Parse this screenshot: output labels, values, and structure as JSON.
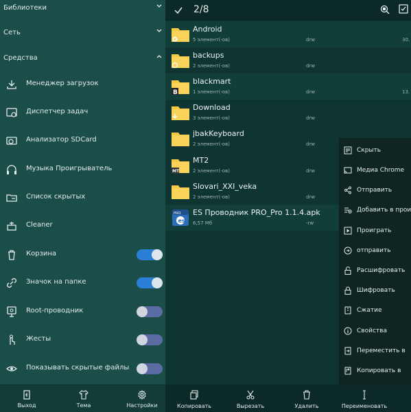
{
  "drawer": {
    "sections": [
      {
        "label": "Библиотеки",
        "expanded": false
      },
      {
        "label": "Сеть",
        "expanded": false
      },
      {
        "label": "Средства",
        "expanded": true
      }
    ],
    "items": [
      {
        "label": "Менеджер загрузок",
        "icon": "download-icon"
      },
      {
        "label": "Диспетчер задач",
        "icon": "task-manager-icon"
      },
      {
        "label": "Анализатор SDCard",
        "icon": "sdcard-analyzer-icon"
      },
      {
        "label": "Музыка Проигрыватель",
        "icon": "headphones-icon"
      },
      {
        "label": "Список скрытых",
        "icon": "hidden-list-icon"
      },
      {
        "label": "Cleaner",
        "icon": "cleaner-icon"
      },
      {
        "label": "Корзина",
        "icon": "trash-icon",
        "toggle": true
      },
      {
        "label": "Значок на папке",
        "icon": "link-icon",
        "toggle": true
      },
      {
        "label": "Root-проводник",
        "icon": "root-icon",
        "toggle": false
      },
      {
        "label": "Жесты",
        "icon": "gesture-icon",
        "toggle": false
      },
      {
        "label": "Показывать скрытые файлы",
        "icon": "eye-icon",
        "toggle": false
      }
    ],
    "bottom": [
      {
        "label": "Выход",
        "icon": "exit-icon"
      },
      {
        "label": "Тема",
        "icon": "shirt-icon"
      },
      {
        "label": "Настройки",
        "icon": "gear-icon"
      }
    ]
  },
  "topbar": {
    "selection_count": "2/8"
  },
  "files": [
    {
      "name": "Android",
      "info": "5 элемент(-ов)",
      "perm": "drw",
      "date": "30.",
      "badge": "gear",
      "selected": true
    },
    {
      "name": "backups",
      "info": "2 элемент(-ов)",
      "perm": "drw",
      "date": "",
      "badge": "backup",
      "selected": false
    },
    {
      "name": "blackmart",
      "info": "1 элемент(-ов)",
      "perm": "drw",
      "date": "13.",
      "badge": "B",
      "selected": true
    },
    {
      "name": "Download",
      "info": "3 элемент(-ов)",
      "perm": "drw",
      "date": "",
      "badge": "download",
      "selected": false
    },
    {
      "name": "jbakKeyboard",
      "info": "2 элемент(-ов)",
      "perm": "drw",
      "date": "",
      "badge": "",
      "selected": false
    },
    {
      "name": "MT2",
      "info": "2 элемент(-ов)",
      "perm": "drw",
      "date": "",
      "badge": "MT",
      "selected": false
    },
    {
      "name": "Slovari_XXI_veka",
      "info": "2 элемент(-ов)",
      "perm": "drw",
      "date": "",
      "badge": "",
      "selected": false
    },
    {
      "name": "ES Проводник PRO_Pro 1.1.4.apk",
      "info": "6,57 Мб",
      "perm": "-rw",
      "date": "",
      "badge": "apk",
      "selected": true
    }
  ],
  "context_menu": [
    {
      "label": "Скрыть",
      "icon": "hide-icon"
    },
    {
      "label": "Медиа Chrome",
      "icon": "cast-icon"
    },
    {
      "label": "Отправить",
      "icon": "share-icon"
    },
    {
      "label": "Добавить в проиг",
      "icon": "playlist-add-icon"
    },
    {
      "label": "Проиграть",
      "icon": "play-icon"
    },
    {
      "label": "отправить",
      "icon": "send-icon"
    },
    {
      "label": "Расшифровать",
      "icon": "unlock-icon"
    },
    {
      "label": "Шифровать",
      "icon": "lock-icon"
    },
    {
      "label": "Сжатие",
      "icon": "compress-icon"
    },
    {
      "label": "Свойства",
      "icon": "info-icon"
    },
    {
      "label": "Переместить в",
      "icon": "move-icon"
    },
    {
      "label": "Копировать в",
      "icon": "copy-to-icon"
    }
  ],
  "bottombar": [
    {
      "label": "Копировать",
      "icon": "copy-icon"
    },
    {
      "label": "Вырезать",
      "icon": "cut-icon"
    },
    {
      "label": "Удалить",
      "icon": "delete-icon"
    },
    {
      "label": "Переименовать",
      "icon": "rename-icon"
    }
  ],
  "colors": {
    "drawer_bg": "#1b4d49",
    "main_bg": "#0e3532",
    "folder_yellow": "#f7c843",
    "toggle_on": "#2c7fd6",
    "toggle_off": "#5b6ca5"
  }
}
